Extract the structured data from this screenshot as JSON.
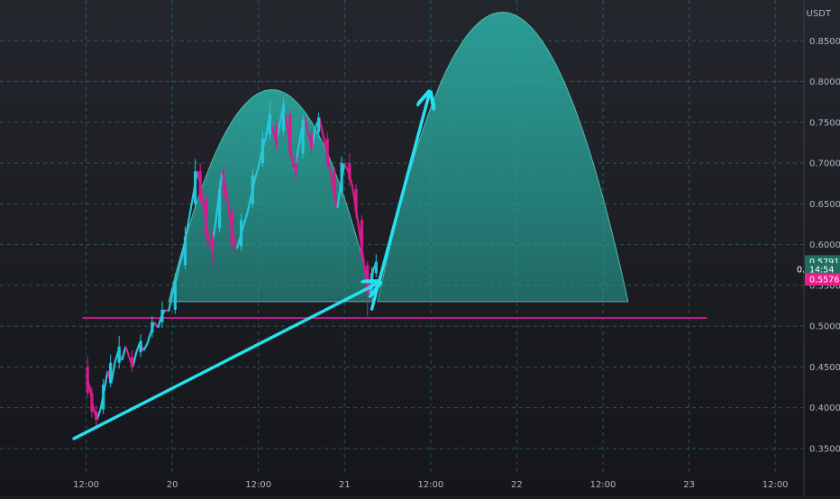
{
  "chart_data": {
    "type": "candlestick",
    "currency": "USDT",
    "title": "",
    "xlabel": "",
    "ylabel": "",
    "y_ticks": [
      0.35,
      0.4,
      0.45,
      0.5,
      0.55,
      0.6,
      0.65,
      0.7,
      0.75,
      0.8,
      0.85
    ],
    "y_tick_labels": [
      "0.35000",
      "0.40000",
      "0.45000",
      "0.50000",
      "0.55000",
      "0.60000",
      "0.65000",
      "0.70000",
      "0.75000",
      "0.80000",
      "0.85000"
    ],
    "ylim": [
      0.32,
      0.9
    ],
    "x_ticks": [
      {
        "hours": 12,
        "label": "12:00"
      },
      {
        "hours": 24,
        "label": "20"
      },
      {
        "hours": 36,
        "label": "12:00"
      },
      {
        "hours": 48,
        "label": "21"
      },
      {
        "hours": 60,
        "label": "12:00"
      },
      {
        "hours": 72,
        "label": "22"
      },
      {
        "hours": 84,
        "label": "12:00"
      },
      {
        "hours": 96,
        "label": "23"
      },
      {
        "hours": 108,
        "label": "12:00"
      }
    ],
    "xlim": [
      0,
      112
    ],
    "price_labels": [
      {
        "value": 0.57918,
        "text": "0.57918",
        "color": "#1f6f5e"
      },
      {
        "value": 0.5695,
        "text": "14:54",
        "color": "#1f6f5e"
      },
      {
        "value": 0.55761,
        "text": "0.55761",
        "color": "#e91e8c"
      }
    ],
    "countdown_label_prefix": "0.",
    "support_line": {
      "value": 0.51,
      "x_start": 11.5,
      "x_end": 98.5,
      "color": "#c2188c"
    },
    "trend_arrow": {
      "from": [
        10.3,
        0.362
      ],
      "to": [
        52.7,
        0.553
      ],
      "color": "#26e0f0"
    },
    "projection_arrow": {
      "from": [
        51.8,
        0.521
      ],
      "to": [
        59.8,
        0.785
      ],
      "color": "#26e0f0"
    },
    "arcs": [
      {
        "name": "left-arc",
        "x_start": 23.5,
        "x_end": 52.0,
        "peak_x": 37.9,
        "peak_y": 0.79,
        "base_y": 0.53
      },
      {
        "name": "right-arc",
        "x_start": 52.6,
        "x_end": 87.5,
        "peak_x": 70.0,
        "peak_y": 0.885,
        "base_y": 0.53
      }
    ],
    "price_path": [
      [
        12.0,
        0.44
      ],
      [
        12.5,
        0.425
      ],
      [
        13.0,
        0.4
      ],
      [
        13.5,
        0.385
      ],
      [
        14.0,
        0.398
      ],
      [
        14.5,
        0.42
      ],
      [
        15.0,
        0.445
      ],
      [
        15.5,
        0.43
      ],
      [
        16.0,
        0.455
      ],
      [
        16.5,
        0.47
      ],
      [
        17.0,
        0.458
      ],
      [
        17.5,
        0.475
      ],
      [
        18.0,
        0.462
      ],
      [
        18.5,
        0.45
      ],
      [
        19.0,
        0.468
      ],
      [
        19.5,
        0.48
      ],
      [
        20.0,
        0.47
      ],
      [
        20.5,
        0.478
      ],
      [
        21.0,
        0.492
      ],
      [
        21.5,
        0.505
      ],
      [
        22.0,
        0.498
      ],
      [
        22.5,
        0.512
      ],
      [
        23.0,
        0.52
      ],
      [
        23.5,
        0.518
      ],
      [
        24.0,
        0.54
      ],
      [
        24.5,
        0.555
      ],
      [
        25.0,
        0.575
      ],
      [
        25.5,
        0.59
      ],
      [
        26.0,
        0.615
      ],
      [
        26.5,
        0.64
      ],
      [
        27.0,
        0.665
      ],
      [
        27.5,
        0.69
      ],
      [
        28.0,
        0.67
      ],
      [
        28.5,
        0.64
      ],
      [
        29.0,
        0.61
      ],
      [
        29.5,
        0.595
      ],
      [
        30.0,
        0.625
      ],
      [
        30.5,
        0.66
      ],
      [
        31.0,
        0.69
      ],
      [
        31.5,
        0.665
      ],
      [
        32.0,
        0.635
      ],
      [
        32.5,
        0.61
      ],
      [
        33.0,
        0.595
      ],
      [
        33.5,
        0.61
      ],
      [
        34.0,
        0.625
      ],
      [
        34.5,
        0.64
      ],
      [
        35.0,
        0.66
      ],
      [
        35.5,
        0.68
      ],
      [
        36.0,
        0.695
      ],
      [
        36.5,
        0.715
      ],
      [
        37.0,
        0.73
      ],
      [
        37.5,
        0.755
      ],
      [
        38.0,
        0.74
      ],
      [
        38.5,
        0.725
      ],
      [
        39.0,
        0.75
      ],
      [
        39.5,
        0.77
      ],
      [
        40.0,
        0.745
      ],
      [
        40.5,
        0.715
      ],
      [
        41.0,
        0.69
      ],
      [
        41.5,
        0.715
      ],
      [
        42.0,
        0.74
      ],
      [
        42.5,
        0.755
      ],
      [
        43.0,
        0.735
      ],
      [
        43.5,
        0.72
      ],
      [
        44.0,
        0.745
      ],
      [
        44.5,
        0.755
      ],
      [
        45.0,
        0.735
      ],
      [
        45.5,
        0.715
      ],
      [
        46.0,
        0.69
      ],
      [
        46.5,
        0.665
      ],
      [
        47.0,
        0.645
      ],
      [
        47.5,
        0.675
      ],
      [
        48.0,
        0.7
      ],
      [
        48.5,
        0.69
      ],
      [
        49.0,
        0.675
      ],
      [
        49.5,
        0.65
      ],
      [
        50.0,
        0.62
      ],
      [
        50.5,
        0.59
      ],
      [
        51.0,
        0.56
      ],
      [
        51.5,
        0.54
      ],
      [
        52.0,
        0.57
      ],
      [
        52.5,
        0.579
      ]
    ],
    "candles": [
      {
        "x": 12.2,
        "o": 0.45,
        "c": 0.418,
        "h": 0.462,
        "l": 0.412
      },
      {
        "x": 12.8,
        "o": 0.418,
        "c": 0.395,
        "h": 0.425,
        "l": 0.388
      },
      {
        "x": 13.4,
        "o": 0.395,
        "c": 0.385,
        "h": 0.402,
        "l": 0.378
      },
      {
        "x": 14.4,
        "o": 0.398,
        "c": 0.428,
        "h": 0.435,
        "l": 0.392
      },
      {
        "x": 15.4,
        "o": 0.43,
        "c": 0.455,
        "h": 0.465,
        "l": 0.425
      },
      {
        "x": 16.6,
        "o": 0.455,
        "c": 0.475,
        "h": 0.488,
        "l": 0.448
      },
      {
        "x": 18.4,
        "o": 0.462,
        "c": 0.45,
        "h": 0.47,
        "l": 0.444
      },
      {
        "x": 19.6,
        "o": 0.468,
        "c": 0.482,
        "h": 0.49,
        "l": 0.462
      },
      {
        "x": 21.2,
        "o": 0.492,
        "c": 0.505,
        "h": 0.512,
        "l": 0.486
      },
      {
        "x": 22.6,
        "o": 0.505,
        "c": 0.52,
        "h": 0.53,
        "l": 0.498
      },
      {
        "x": 24.4,
        "o": 0.52,
        "c": 0.556,
        "h": 0.565,
        "l": 0.515
      },
      {
        "x": 25.8,
        "o": 0.575,
        "c": 0.61,
        "h": 0.622,
        "l": 0.57
      },
      {
        "x": 27.2,
        "o": 0.65,
        "c": 0.69,
        "h": 0.705,
        "l": 0.645
      },
      {
        "x": 27.9,
        "o": 0.69,
        "c": 0.655,
        "h": 0.7,
        "l": 0.65
      },
      {
        "x": 28.7,
        "o": 0.655,
        "c": 0.61,
        "h": 0.66,
        "l": 0.6
      },
      {
        "x": 29.6,
        "o": 0.61,
        "c": 0.592,
        "h": 0.618,
        "l": 0.575
      },
      {
        "x": 30.6,
        "o": 0.62,
        "c": 0.668,
        "h": 0.678,
        "l": 0.615
      },
      {
        "x": 31.2,
        "o": 0.68,
        "c": 0.66,
        "h": 0.695,
        "l": 0.652
      },
      {
        "x": 32.3,
        "o": 0.64,
        "c": 0.6,
        "h": 0.645,
        "l": 0.59
      },
      {
        "x": 33.6,
        "o": 0.598,
        "c": 0.63,
        "h": 0.638,
        "l": 0.592
      },
      {
        "x": 35.2,
        "o": 0.65,
        "c": 0.685,
        "h": 0.692,
        "l": 0.645
      },
      {
        "x": 36.6,
        "o": 0.7,
        "c": 0.73,
        "h": 0.74,
        "l": 0.695
      },
      {
        "x": 37.6,
        "o": 0.735,
        "c": 0.76,
        "h": 0.775,
        "l": 0.728
      },
      {
        "x": 38.5,
        "o": 0.745,
        "c": 0.722,
        "h": 0.752,
        "l": 0.715
      },
      {
        "x": 39.5,
        "o": 0.74,
        "c": 0.772,
        "h": 0.78,
        "l": 0.735
      },
      {
        "x": 40.4,
        "o": 0.76,
        "c": 0.712,
        "h": 0.765,
        "l": 0.705
      },
      {
        "x": 41.2,
        "o": 0.7,
        "c": 0.688,
        "h": 0.712,
        "l": 0.68
      },
      {
        "x": 42.2,
        "o": 0.712,
        "c": 0.752,
        "h": 0.76,
        "l": 0.705
      },
      {
        "x": 43.4,
        "o": 0.735,
        "c": 0.718,
        "h": 0.742,
        "l": 0.71
      },
      {
        "x": 44.4,
        "o": 0.738,
        "c": 0.756,
        "h": 0.762,
        "l": 0.73
      },
      {
        "x": 45.6,
        "o": 0.73,
        "c": 0.7,
        "h": 0.738,
        "l": 0.692
      },
      {
        "x": 46.6,
        "o": 0.69,
        "c": 0.66,
        "h": 0.695,
        "l": 0.65
      },
      {
        "x": 47.6,
        "o": 0.665,
        "c": 0.7,
        "h": 0.708,
        "l": 0.658
      },
      {
        "x": 48.7,
        "o": 0.7,
        "c": 0.68,
        "h": 0.712,
        "l": 0.672
      },
      {
        "x": 49.6,
        "o": 0.668,
        "c": 0.64,
        "h": 0.674,
        "l": 0.632
      },
      {
        "x": 50.4,
        "o": 0.63,
        "c": 0.585,
        "h": 0.636,
        "l": 0.578
      },
      {
        "x": 51.2,
        "o": 0.575,
        "c": 0.54,
        "h": 0.58,
        "l": 0.512
      },
      {
        "x": 51.8,
        "o": 0.545,
        "c": 0.565,
        "h": 0.572,
        "l": 0.538
      },
      {
        "x": 52.4,
        "o": 0.565,
        "c": 0.579,
        "h": 0.588,
        "l": 0.56
      }
    ],
    "colors": {
      "up": "#26c6da",
      "down": "#d81b8c",
      "arc_fill": "#26a69a",
      "grid": "#2a8c7a",
      "axis_text": "#b2b5be",
      "background": "#1c1d24"
    },
    "grid": true
  }
}
